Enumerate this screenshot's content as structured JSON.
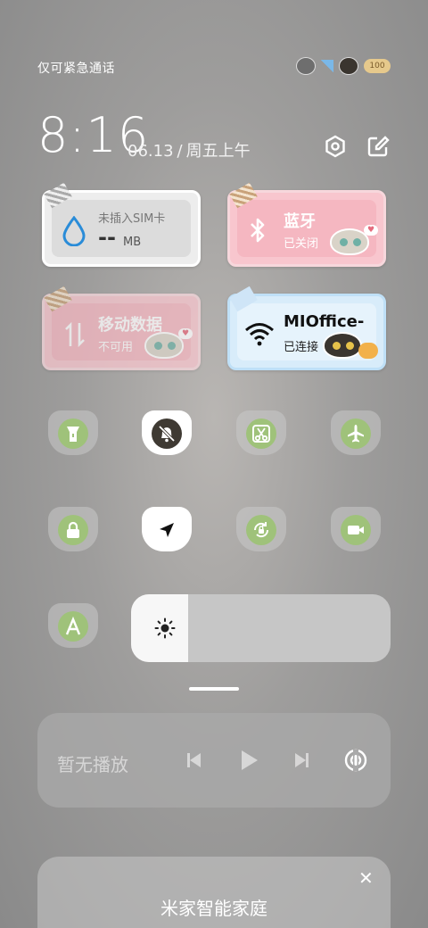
{
  "status_bar": {
    "carrier_text": "仅可紧急通话",
    "battery_text": "100"
  },
  "header": {
    "time": "8:16",
    "date": "06.13",
    "separator": "/",
    "weekday": "周五上午"
  },
  "tiles": {
    "sim": {
      "title": "未插入SIM卡",
      "value": "--",
      "unit": "MB"
    },
    "bluetooth": {
      "title": "蓝牙",
      "status": "已关闭"
    },
    "mobile_data": {
      "title": "移动数据",
      "status": "不可用"
    },
    "wifi": {
      "title": "MIOffice-",
      "status": "已连接"
    }
  },
  "toggles": [
    {
      "name": "flashlight",
      "on": false
    },
    {
      "name": "silent",
      "on": true
    },
    {
      "name": "screenshot",
      "on": false
    },
    {
      "name": "airplane",
      "on": false
    },
    {
      "name": "lock-screen",
      "on": false
    },
    {
      "name": "location",
      "on": true
    },
    {
      "name": "rotation-lock",
      "on": false
    },
    {
      "name": "screen-recorder",
      "on": false
    },
    {
      "name": "auto-brightness",
      "on": false
    }
  ],
  "brightness": {
    "level": 0.22
  },
  "media": {
    "title": "暂无播放"
  },
  "smart_home": {
    "title": "米家智能家庭",
    "close": "✕"
  }
}
